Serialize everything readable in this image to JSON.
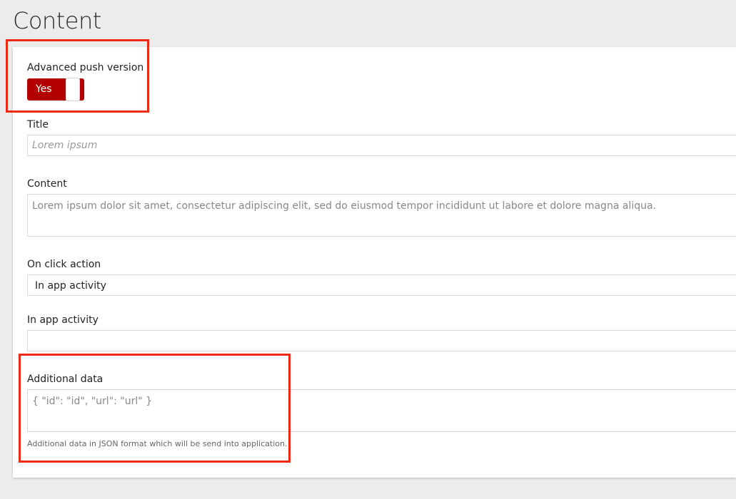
{
  "page": {
    "title": "Content"
  },
  "form": {
    "advanced_push": {
      "label": "Advanced push version",
      "value": "Yes",
      "checked": true
    },
    "title": {
      "label": "Title",
      "value": "",
      "placeholder": "Lorem ipsum"
    },
    "content": {
      "label": "Content",
      "value": "Lorem ipsum dolor sit amet, consectetur adipiscing elit, sed do eiusmod tempor incididunt ut labore et dolore magna aliqua."
    },
    "on_click_action": {
      "label": "On click action",
      "selected": "In app activity"
    },
    "in_app_activity": {
      "label": "In app activity",
      "value": ""
    },
    "additional_data": {
      "label": "Additional data",
      "value": "{ \"id\": \"id\", \"url\": \"url\" }",
      "help": "Additional data in JSON format which will be send into application."
    }
  },
  "colors": {
    "toggle_on": "#b30000",
    "highlight": "#ee2a15",
    "background": "#ececec"
  }
}
